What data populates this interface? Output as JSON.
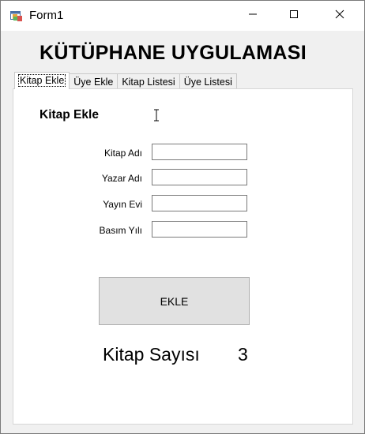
{
  "window": {
    "title": "Form1",
    "icons": [
      "app-form-icon",
      "minimize-icon",
      "maximize-icon",
      "close-icon"
    ]
  },
  "app": {
    "heading": "KÜTÜPHANE UYGULAMASI"
  },
  "tabs": [
    {
      "label": "Kitap Ekle",
      "active": true
    },
    {
      "label": "Üye Ekle",
      "active": false
    },
    {
      "label": "Kitap Listesi",
      "active": false
    },
    {
      "label": "Üye Listesi",
      "active": false
    }
  ],
  "form": {
    "section_title": "Kitap Ekle",
    "fields": [
      {
        "label": "Kitap Adı",
        "value": ""
      },
      {
        "label": "Yazar Adı",
        "value": ""
      },
      {
        "label": "Yayın Evi",
        "value": ""
      },
      {
        "label": "Basım Yılı",
        "value": ""
      }
    ],
    "submit_label": "EKLE"
  },
  "stats": {
    "count_label": "Kitap Sayısı",
    "count_value": "3"
  }
}
